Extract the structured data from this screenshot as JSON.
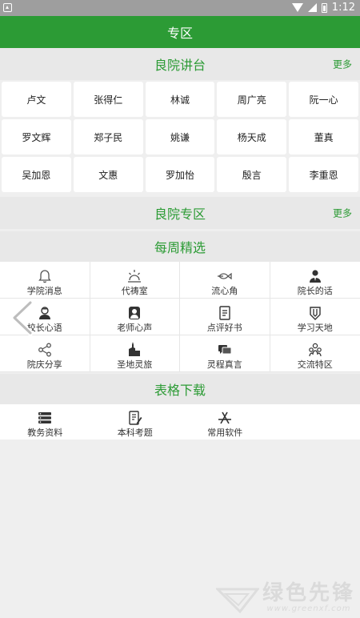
{
  "status": {
    "time": "1:12"
  },
  "header": {
    "title": "专区"
  },
  "lecture": {
    "title": "良院讲台",
    "more": "更多",
    "names": [
      "卢文",
      "张得仁",
      "林诚",
      "周广亮",
      "阮一心",
      "罗文辉",
      "郑子民",
      "姚谦",
      "杨天成",
      "董真",
      "吴加恩",
      "文惠",
      "罗加怡",
      "殷言",
      "李重恩"
    ]
  },
  "zone": {
    "title": "良院专区",
    "more": "更多"
  },
  "weekly": {
    "title": "每周精选",
    "items": [
      {
        "label": "学院消息",
        "icon": "bell-icon"
      },
      {
        "label": "代祷室",
        "icon": "sunrise-icon"
      },
      {
        "label": "流心角",
        "icon": "fish-icon"
      },
      {
        "label": "院长的话",
        "icon": "person-tie-icon"
      },
      {
        "label": "校长心语",
        "icon": "person-icon"
      },
      {
        "label": "老师心声",
        "icon": "teacher-icon"
      },
      {
        "label": "点评好书",
        "icon": "book-icon"
      },
      {
        "label": "学习天地",
        "icon": "pencil-badge-icon"
      },
      {
        "label": "院庆分享",
        "icon": "share-icon"
      },
      {
        "label": "圣地灵旅",
        "icon": "church-icon"
      },
      {
        "label": "灵程真言",
        "icon": "chat-icon"
      },
      {
        "label": "交流特区",
        "icon": "group-icon"
      }
    ]
  },
  "forms": {
    "title": "表格下载",
    "items": [
      {
        "label": "教务资料",
        "icon": "database-icon"
      },
      {
        "label": "本科考题",
        "icon": "document-edit-icon"
      },
      {
        "label": "常用软件",
        "icon": "appstore-icon"
      }
    ]
  },
  "watermark": {
    "title": "绿色先锋",
    "url": "www.greenxf.com"
  }
}
